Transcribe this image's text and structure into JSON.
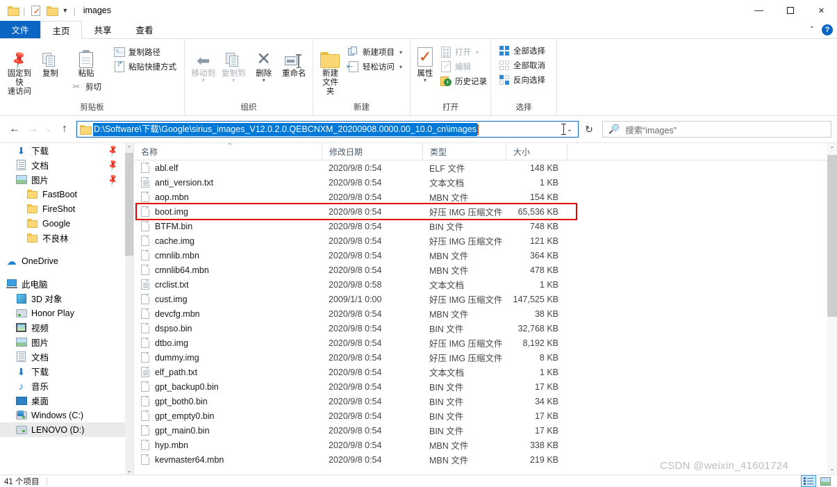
{
  "window": {
    "title": "images",
    "quick_access": [
      "folder-icon",
      "properties-icon",
      "new-folder-icon"
    ],
    "controls": {
      "minimize": "—",
      "maximize": "□",
      "close": "✕"
    }
  },
  "tabs": [
    {
      "label": "文件",
      "id": "file"
    },
    {
      "label": "主页",
      "id": "home"
    },
    {
      "label": "共享",
      "id": "share"
    },
    {
      "label": "查看",
      "id": "view"
    }
  ],
  "ribbon": {
    "collapse_icon": "chevron-up-icon",
    "help_icon": "help-icon",
    "groups": [
      {
        "label": "剪贴板",
        "big": [
          {
            "label": "固定到快速访问",
            "icon": "pin-icon",
            "line1": "固定到快",
            "line2": "速访问"
          },
          {
            "label": "复制",
            "icon": "copy-icon"
          },
          {
            "label": "粘贴",
            "icon": "paste-icon"
          }
        ],
        "small_under_paste": [
          {
            "label": "剪切",
            "icon": "scissors-icon"
          }
        ],
        "small": [
          {
            "label": "复制路径",
            "icon": "copy-path-icon"
          },
          {
            "label": "粘贴快捷方式",
            "icon": "paste-shortcut-icon"
          }
        ]
      },
      {
        "label": "组织",
        "big": [
          {
            "label": "移动到",
            "icon": "move-to-icon",
            "dim": true,
            "caret": true
          },
          {
            "label": "复制到",
            "icon": "copy-to-icon",
            "dim": true,
            "caret": true
          },
          {
            "label": "删除",
            "icon": "delete-icon",
            "caret": true
          },
          {
            "label": "重命名",
            "icon": "rename-icon"
          }
        ]
      },
      {
        "label": "新建",
        "big": [
          {
            "label": "新建文件夹",
            "icon": "new-folder-icon",
            "line1": "新建",
            "line2": "文件夹"
          }
        ],
        "small": [
          {
            "label": "新建项目",
            "icon": "new-item-icon",
            "caret": true
          },
          {
            "label": "轻松访问",
            "icon": "easy-access-icon",
            "caret": true
          }
        ]
      },
      {
        "label": "打开",
        "big": [
          {
            "label": "属性",
            "icon": "properties-icon",
            "caret": true
          }
        ],
        "small": [
          {
            "label": "打开",
            "icon": "open-icon",
            "dim": true,
            "caret": true
          },
          {
            "label": "编辑",
            "icon": "edit-icon",
            "dim": true
          },
          {
            "label": "历史记录",
            "icon": "history-icon"
          }
        ]
      },
      {
        "label": "选择",
        "small": [
          {
            "label": "全部选择",
            "icon": "select-all-icon"
          },
          {
            "label": "全部取消",
            "icon": "select-none-icon"
          },
          {
            "label": "反向选择",
            "icon": "invert-selection-icon"
          }
        ]
      }
    ]
  },
  "addressbar": {
    "back_icon": "arrow-left-icon",
    "forward_icon": "arrow-right-icon",
    "recent_icon": "chevron-down-icon",
    "up_icon": "arrow-up-icon",
    "path": "D:\\Software\\下载\\Google\\sirius_images_V12.0.2.0.QEBCNXM_20200908.0000.00_10.0_cn\\images",
    "dropdown_icon": "chevron-down-icon",
    "refresh_icon": "refresh-icon",
    "search_placeholder": "搜索“images”",
    "search_icon": "search-icon"
  },
  "navpane": {
    "items": [
      {
        "label": "下载",
        "icon": "download-icon",
        "indent": 1,
        "pinned": true
      },
      {
        "label": "文档",
        "icon": "documents-icon",
        "indent": 1,
        "pinned": true
      },
      {
        "label": "图片",
        "icon": "pictures-icon",
        "indent": 1,
        "pinned": true
      },
      {
        "label": "FastBoot",
        "icon": "folder-icon",
        "indent": 2
      },
      {
        "label": "FireShot",
        "icon": "folder-icon",
        "indent": 2
      },
      {
        "label": "Google",
        "icon": "folder-icon",
        "indent": 2
      },
      {
        "label": "不良林",
        "icon": "folder-icon",
        "indent": 2
      },
      {
        "label": "OneDrive",
        "icon": "onedrive-icon",
        "indent": 0,
        "spacer_before": true
      },
      {
        "label": "此电脑",
        "icon": "this-pc-icon",
        "indent": 0,
        "spacer_before": true
      },
      {
        "label": "3D 对象",
        "icon": "3d-objects-icon",
        "indent": 1
      },
      {
        "label": "Honor Play",
        "icon": "phone-icon",
        "indent": 1
      },
      {
        "label": "视频",
        "icon": "videos-icon",
        "indent": 1
      },
      {
        "label": "图片",
        "icon": "pictures-icon",
        "indent": 1
      },
      {
        "label": "文档",
        "icon": "documents-icon",
        "indent": 1
      },
      {
        "label": "下载",
        "icon": "download-icon",
        "indent": 1
      },
      {
        "label": "音乐",
        "icon": "music-icon",
        "indent": 1
      },
      {
        "label": "桌面",
        "icon": "desktop-icon",
        "indent": 1
      },
      {
        "label": "Windows (C:)",
        "icon": "windows-drive-icon",
        "indent": 1
      },
      {
        "label": "LENOVO (D:)",
        "icon": "drive-icon",
        "indent": 1,
        "selected": true
      }
    ]
  },
  "filelist": {
    "columns": [
      {
        "label": "名称",
        "sorted": true
      },
      {
        "label": "修改日期",
        "sorted": false
      },
      {
        "label": "类型",
        "sorted": false
      },
      {
        "label": "大小",
        "sorted": false
      }
    ],
    "rows": [
      {
        "name": "abl.elf",
        "date": "2020/9/8 0:54",
        "type": "ELF 文件",
        "size": "148 KB",
        "icon": "file-icon"
      },
      {
        "name": "anti_version.txt",
        "date": "2020/9/8 0:54",
        "type": "文本文档",
        "size": "1 KB",
        "icon": "text-file-icon"
      },
      {
        "name": "aop.mbn",
        "date": "2020/9/8 0:54",
        "type": "MBN 文件",
        "size": "154 KB",
        "icon": "file-icon"
      },
      {
        "name": "boot.img",
        "date": "2020/9/8 0:54",
        "type": "好压 IMG 压缩文件",
        "size": "65,536 KB",
        "icon": "file-icon",
        "highlighted": true
      },
      {
        "name": "BTFM.bin",
        "date": "2020/9/8 0:54",
        "type": "BIN 文件",
        "size": "748 KB",
        "icon": "file-icon"
      },
      {
        "name": "cache.img",
        "date": "2020/9/8 0:54",
        "type": "好压 IMG 压缩文件",
        "size": "121 KB",
        "icon": "file-icon"
      },
      {
        "name": "cmnlib.mbn",
        "date": "2020/9/8 0:54",
        "type": "MBN 文件",
        "size": "364 KB",
        "icon": "file-icon"
      },
      {
        "name": "cmnlib64.mbn",
        "date": "2020/9/8 0:54",
        "type": "MBN 文件",
        "size": "478 KB",
        "icon": "file-icon"
      },
      {
        "name": "crclist.txt",
        "date": "2020/9/8 0:58",
        "type": "文本文档",
        "size": "1 KB",
        "icon": "text-file-icon"
      },
      {
        "name": "cust.img",
        "date": "2009/1/1 0:00",
        "type": "好压 IMG 压缩文件",
        "size": "147,525 KB",
        "icon": "file-icon"
      },
      {
        "name": "devcfg.mbn",
        "date": "2020/9/8 0:54",
        "type": "MBN 文件",
        "size": "38 KB",
        "icon": "file-icon"
      },
      {
        "name": "dspso.bin",
        "date": "2020/9/8 0:54",
        "type": "BIN 文件",
        "size": "32,768 KB",
        "icon": "file-icon"
      },
      {
        "name": "dtbo.img",
        "date": "2020/9/8 0:54",
        "type": "好压 IMG 压缩文件",
        "size": "8,192 KB",
        "icon": "file-icon"
      },
      {
        "name": "dummy.img",
        "date": "2020/9/8 0:54",
        "type": "好压 IMG 压缩文件",
        "size": "8 KB",
        "icon": "file-icon"
      },
      {
        "name": "elf_path.txt",
        "date": "2020/9/8 0:54",
        "type": "文本文档",
        "size": "1 KB",
        "icon": "text-file-icon"
      },
      {
        "name": "gpt_backup0.bin",
        "date": "2020/9/8 0:54",
        "type": "BIN 文件",
        "size": "17 KB",
        "icon": "file-icon"
      },
      {
        "name": "gpt_both0.bin",
        "date": "2020/9/8 0:54",
        "type": "BIN 文件",
        "size": "34 KB",
        "icon": "file-icon"
      },
      {
        "name": "gpt_empty0.bin",
        "date": "2020/9/8 0:54",
        "type": "BIN 文件",
        "size": "17 KB",
        "icon": "file-icon"
      },
      {
        "name": "gpt_main0.bin",
        "date": "2020/9/8 0:54",
        "type": "BIN 文件",
        "size": "17 KB",
        "icon": "file-icon"
      },
      {
        "name": "hyp.mbn",
        "date": "2020/9/8 0:54",
        "type": "MBN 文件",
        "size": "338 KB",
        "icon": "file-icon"
      },
      {
        "name": "kevmaster64.mbn",
        "date": "2020/9/8 0:54",
        "type": "MBN 文件",
        "size": "219 KB",
        "icon": "file-icon"
      }
    ],
    "highlight_color": "#e50000"
  },
  "statusbar": {
    "item_count": "41 个项目",
    "view_details_icon": "details-view-icon",
    "view_large_icon": "large-icons-view-icon"
  },
  "watermark": "CSDN @weixin_41601724"
}
